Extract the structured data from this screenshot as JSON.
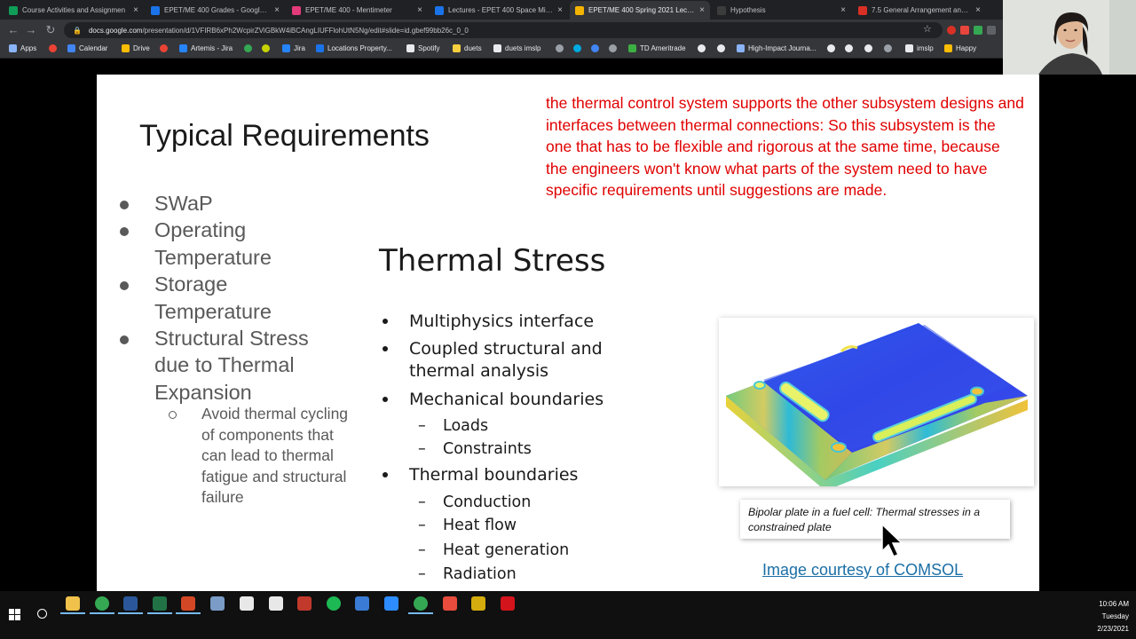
{
  "browser": {
    "tabs": [
      {
        "label": "Course Activities and Assignmen",
        "color": "#0f9d58",
        "active": false
      },
      {
        "label": "EPET/ME 400 Grades - Google Dr",
        "color": "#1a73e8",
        "active": false
      },
      {
        "label": "EPET/ME 400 - Mentimeter",
        "color": "#e23a7a",
        "active": false
      },
      {
        "label": "Lectures - EPET 400 Space Missi",
        "color": "#1a73e8",
        "active": false
      },
      {
        "label": "EPET/ME 400 Spring 2021 Lectur",
        "color": "#f4b400",
        "active": true
      },
      {
        "label": "Hypothesis",
        "color": "#3c3c3c",
        "active": false
      },
      {
        "label": "7.5 General Arrangement and De",
        "color": "#d93025",
        "active": false
      }
    ],
    "tab_close": "×",
    "new_tab": "+",
    "url_prefix": "docs.google.com",
    "url_rest": "/presentation/d/1VFIRB6xPh2WcpirZViGBkW4iBCAngLIUFFlohUtN5Ng/edit#slide=id.gbef99bb26c_0_0",
    "back_icon": "←",
    "forward_icon": "→",
    "reload_icon": "↻",
    "lock_icon": "🔒",
    "star_icon": "☆",
    "bookmarks": [
      {
        "label": "Apps",
        "color": "#8ab4f8"
      },
      {
        "label": "",
        "color": "#ea4335"
      },
      {
        "label": "Calendar",
        "color": "#4285f4"
      },
      {
        "label": "Drive",
        "color": "#fbbc04"
      },
      {
        "label": "",
        "color": "#ea4335"
      },
      {
        "label": "Artemis - Jira",
        "color": "#2684ff"
      },
      {
        "label": "",
        "color": "#34a853"
      },
      {
        "label": "",
        "color": "#c6d300"
      },
      {
        "label": "Jira",
        "color": "#2684ff"
      },
      {
        "label": "Locations Property...",
        "color": "#1a73e8"
      },
      {
        "label": "Spotify",
        "color": "#e8eaed"
      },
      {
        "label": "duets",
        "color": "#f4d03f"
      },
      {
        "label": "duets imslp",
        "color": "#e8eaed"
      },
      {
        "label": "",
        "color": "#9aa0a6"
      },
      {
        "label": "",
        "color": "#00a9e0"
      },
      {
        "label": "",
        "color": "#4285f4"
      },
      {
        "label": "",
        "color": "#9aa0a6"
      },
      {
        "label": "TD Ameritrade",
        "color": "#3cb043"
      },
      {
        "label": "",
        "color": "#e8eaed"
      },
      {
        "label": "",
        "color": "#e8eaed"
      },
      {
        "label": "High-Impact Journa...",
        "color": "#8ab4f8"
      },
      {
        "label": "",
        "color": "#e8eaed"
      },
      {
        "label": "",
        "color": "#e8eaed"
      },
      {
        "label": "",
        "color": "#e8eaed"
      },
      {
        "label": "",
        "color": "#9aa0a6"
      },
      {
        "label": "imslp",
        "color": "#e8eaed"
      },
      {
        "label": "Happy",
        "color": "#fbbc04"
      }
    ]
  },
  "slide": {
    "title": "Typical Requirements",
    "note": "the thermal control system supports the other subsystem designs and interfaces between thermal connections: So this subsystem is the one that has to be flexible and rigorous at the same time, because the engineers won't know what parts of the system need to have specific requirements until suggestions are made.",
    "left_bullets": [
      "SWaP",
      "Operating Temperature",
      "Storage Temperature",
      "Structural Stress due to Thermal Expansion"
    ],
    "left_sub": "Avoid thermal cycling of components that can lead to thermal fatigue and structural failure",
    "thermal_stress": {
      "title": "Thermal Stress",
      "items": [
        {
          "level": 1,
          "text": "Multiphysics interface"
        },
        {
          "level": 1,
          "text": "Coupled structural and thermal analysis"
        },
        {
          "level": 1,
          "text": "Mechanical boundaries"
        },
        {
          "level": 2,
          "text": "Loads"
        },
        {
          "level": 2,
          "text": "Constraints"
        },
        {
          "level": 1,
          "text": "Thermal boundaries"
        },
        {
          "level": 2,
          "text": "Conduction"
        },
        {
          "level": 2,
          "text": "Heat flow"
        },
        {
          "level": 2,
          "text": "Heat generation"
        },
        {
          "level": 2,
          "text": "Radiation"
        }
      ],
      "dash": "–"
    },
    "caption": "Bipolar plate in a fuel cell: Thermal stresses in a constrained plate",
    "courtesy_link": "Image courtesy of COMSOL"
  },
  "taskbar": {
    "time": "10:06 AM",
    "day": "Tuesday",
    "date": "2/23/2021",
    "apps": [
      {
        "name": "file-explorer-icon",
        "color": "#f0c14b"
      },
      {
        "name": "chrome-icon",
        "color": "#34a853"
      },
      {
        "name": "word-icon",
        "color": "#2b579a"
      },
      {
        "name": "excel-icon",
        "color": "#217346"
      },
      {
        "name": "powerpoint-icon",
        "color": "#d24726"
      },
      {
        "name": "paint-icon",
        "color": "#7a9cc6"
      },
      {
        "name": "acrobat-icon",
        "color": "#e8e8e8"
      },
      {
        "name": "slack-icon",
        "color": "#e8e8e8"
      },
      {
        "name": "app-red-icon",
        "color": "#c0392b"
      },
      {
        "name": "spotify-icon",
        "color": "#1db954"
      },
      {
        "name": "app-blue-icon",
        "color": "#3a7bd5"
      },
      {
        "name": "zoom-icon",
        "color": "#2d8cff"
      },
      {
        "name": "chrome-active-icon",
        "color": "#34a853"
      },
      {
        "name": "app-gear-icon",
        "color": "#e74c3c"
      },
      {
        "name": "app-compass-icon",
        "color": "#d4ac0d"
      },
      {
        "name": "acrobat-reader-icon",
        "color": "#d4141c"
      }
    ]
  }
}
